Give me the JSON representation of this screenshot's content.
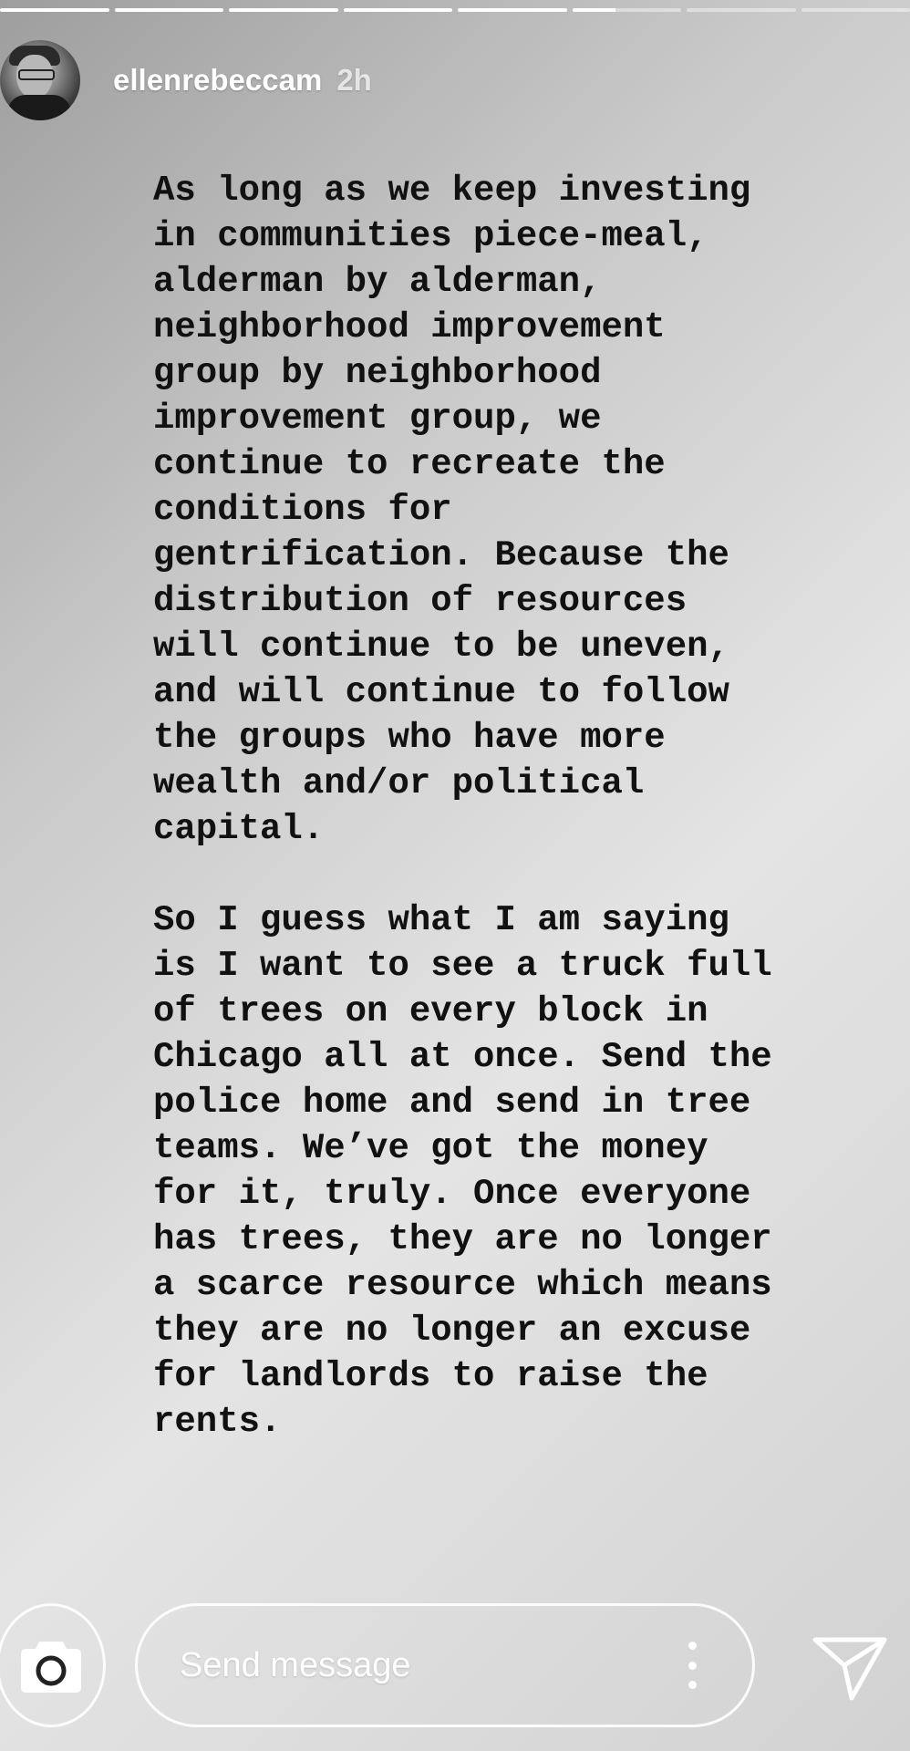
{
  "progress": {
    "segments": 8,
    "active_index": 5,
    "active_fraction": 0.4
  },
  "header": {
    "username": "ellenrebeccam",
    "time_ago": "2h"
  },
  "story": {
    "paragraphs": [
      "As long as we keep investing in communities piece-meal, alderman by alderman, neighborhood improvement group by neighborhood improvement group, we continue to recreate the conditions for gentrification. Because the distribution of resources will continue to be uneven, and will continue to follow the groups who have more wealth and/or political capital.",
      "So I guess what I am saying is I want to see a truck full of trees on every block in Chicago all at once. Send the police home and send in tree teams. We’ve got the money for it, truly. Once everyone has trees, they are no longer a scarce resource which means they are no longer an excuse for landlords to raise the rents."
    ]
  },
  "footer": {
    "message_placeholder": "Send message",
    "camera_icon": "camera-icon",
    "more_icon": "more-vertical-icon",
    "send_icon": "send-paper-plane-icon"
  },
  "colors": {
    "text": "#111111",
    "ui": "#ffffff"
  }
}
